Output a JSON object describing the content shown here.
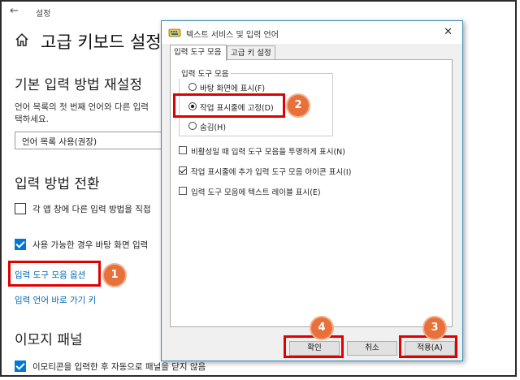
{
  "settings": {
    "app_title": "설정",
    "page_title": "고급 키보드 설정",
    "section_default": "기본 입력 방법 재설정",
    "desc_line1": "언어 목록의 첫 번째 언어와 다른 입력",
    "desc_line2": "택하세요.",
    "dropdown_value": "언어 목록 사용(권장)",
    "section_switch": "입력 방법 전환",
    "cb_per_app": "각 앱 창에 다른 입력 방법을 직접",
    "cb_desktop": "사용 가능한 경우 바탕 화면 입력",
    "link_toolbar": "입력 도구 모음 옵션",
    "link_hotkeys": "입력 언어 바로 가기 키",
    "section_emoji": "이모지 패널",
    "cb_emoji": "이모티콘을 입력한 후 자동으로 패널을 닫지 않음"
  },
  "dialog": {
    "title": "텍스트 서비스 및 입력 언어",
    "close": "✕",
    "tabs": [
      {
        "label": "입력 도구 모음"
      },
      {
        "label": "고급 키 설정"
      }
    ],
    "group_title": "입력 도구 모음",
    "radios": [
      {
        "label": "바탕 화면에 표시(F)",
        "selected": false
      },
      {
        "label": "작업 표시줄에 고정(D)",
        "selected": true
      },
      {
        "label": "숨김(H)",
        "selected": false
      }
    ],
    "checkboxes": [
      {
        "label": "비활성일 때 입력 도구 모음을 투명하게 표시(N)",
        "checked": false
      },
      {
        "label": "작업 표시줄에 추가 입력 도구 모음 아이콘 표시(I)",
        "checked": true
      },
      {
        "label": "입력 도구 모음에 텍스트 레이블 표시(E)",
        "checked": false
      }
    ],
    "buttons": {
      "ok": "확인",
      "cancel": "취소",
      "apply": "적용(A)"
    }
  },
  "badges": {
    "b1": "1",
    "b2": "2",
    "b3": "3",
    "b4": "4"
  },
  "colors": {
    "accent": "#0078d7",
    "link": "#0067b8",
    "highlight": "#e00000",
    "badge": "#e8703a"
  },
  "icons": {
    "back": "back-arrow-icon",
    "home": "home-icon",
    "dialog_app": "keyboard-icon",
    "close": "close-icon"
  }
}
